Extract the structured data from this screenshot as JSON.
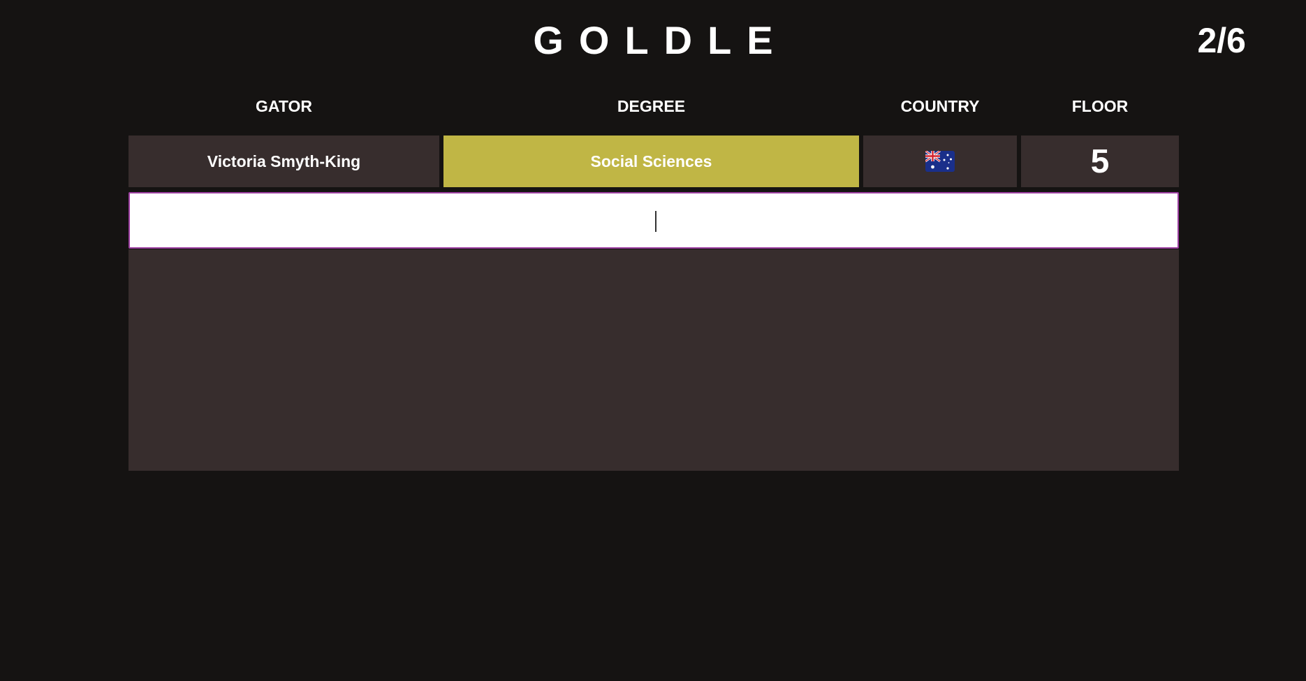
{
  "header": {
    "title": "GOLDLE",
    "counter": "2/6"
  },
  "columns": [
    "GATOR",
    "DEGREE",
    "COUNTRY",
    "FLOOR"
  ],
  "guesses": [
    {
      "gator": "Victoria Smyth-King",
      "degree": "Social Sciences",
      "country_flag": "australia-flag-icon",
      "floor": "5",
      "status": {
        "gator": "incorrect",
        "degree": "partial",
        "country": "incorrect",
        "floor": "incorrect"
      }
    }
  ],
  "colors": {
    "background": "#151312",
    "cell": "#372d2d",
    "partial": "#c0b645",
    "input_border": "#9c3fa0"
  },
  "input": {
    "value": "",
    "placeholder": ""
  }
}
